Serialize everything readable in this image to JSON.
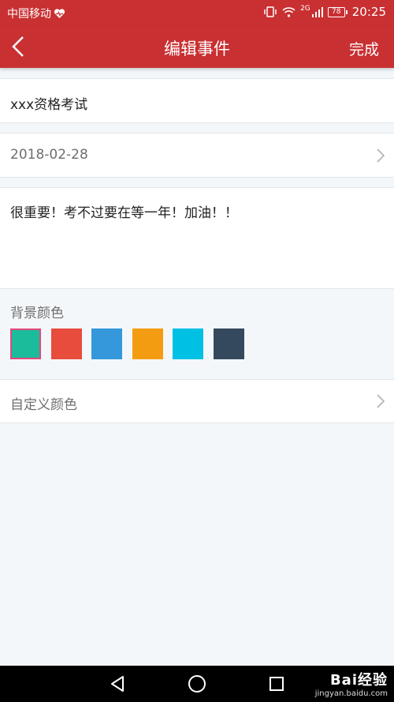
{
  "status_bar": {
    "carrier": "中国移动",
    "network": "2G",
    "battery": "78",
    "time": "20:25"
  },
  "header": {
    "title": "编辑事件",
    "done_label": "完成"
  },
  "form": {
    "event_title": "xxx资格考试",
    "date": "2018-02-28",
    "note": "很重要！考不过要在等一年！加油！！",
    "background_label": "背景颜色",
    "custom_color_label": "自定义颜色"
  },
  "colors": [
    "#1abc9c",
    "#e74c3c",
    "#3498db",
    "#f39c12",
    "#00c0e4",
    "#34495e"
  ],
  "selected_color_index": 0,
  "theme": {
    "accent": "#c93032",
    "selected_outline": "#e6477a"
  },
  "watermark": {
    "brand": "Bai经验",
    "url": "jingyan.baidu.com"
  }
}
